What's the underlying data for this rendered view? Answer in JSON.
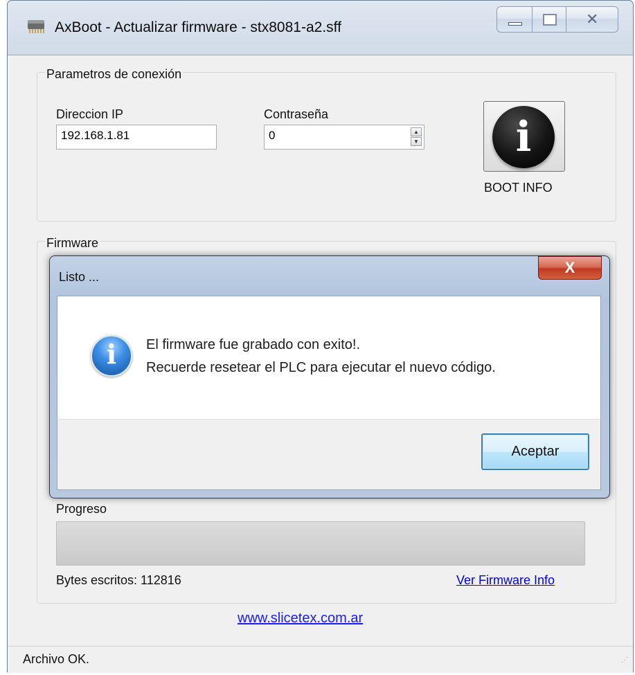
{
  "window": {
    "title": "AxBoot - Actualizar firmware - stx8081-a2.sff",
    "icons": {
      "app": "chip-icon",
      "minimize": "minimize-icon",
      "maximize": "maximize-icon",
      "close": "close-icon"
    }
  },
  "connection": {
    "group_title": "Parametros de conexión",
    "ip_label": "Direccion IP",
    "ip_value": "192.168.1.81",
    "password_label": "Contraseña",
    "password_value": "0",
    "boot_info_label": "BOOT INFO",
    "boot_info_icon": "info-icon",
    "boot_info_glyph": "i"
  },
  "firmware": {
    "group_title": "Firmware",
    "progress_label": "Progreso",
    "progress_value": 0,
    "bytes_written": "Bytes escritos: 112816",
    "info_link": "Ver Firmware Info"
  },
  "footer": {
    "website": "www.slicetex.com.ar",
    "status": "Archivo OK."
  },
  "dialog": {
    "title": "Listo ...",
    "icon": "info-icon",
    "icon_glyph": "i",
    "message_line1": "El firmware fue grabado con exito!.",
    "message_line2": "Recuerde resetear el PLC para ejecutar el nuevo código.",
    "accept_label": "Aceptar",
    "close_glyph": "X"
  },
  "colors": {
    "link": "#0000ee",
    "dialog_close": "#c0391f",
    "accept_border": "#3c7fb1"
  }
}
